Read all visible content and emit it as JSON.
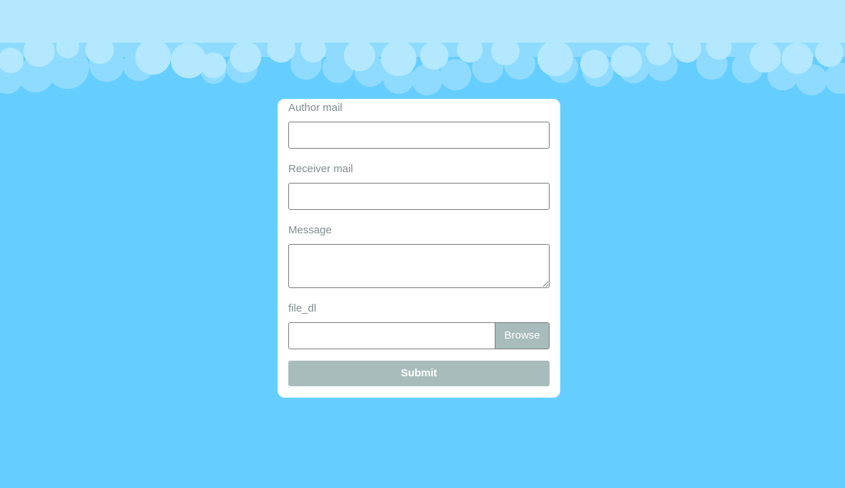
{
  "form": {
    "author_label": "Author mail",
    "author_value": "",
    "receiver_label": "Receiver mail",
    "receiver_value": "",
    "message_label": "Message",
    "message_value": "",
    "file_label": "file_dl",
    "file_value": "",
    "browse_label": "Browse",
    "submit_label": "Submit"
  },
  "colors": {
    "background": "#66ceff",
    "cloud_light": "#b3e8ff",
    "cloud_mid": "#8fdbff",
    "card": "#ffffff",
    "label_text": "#7f8c8d",
    "button": "#a8bcbb"
  }
}
